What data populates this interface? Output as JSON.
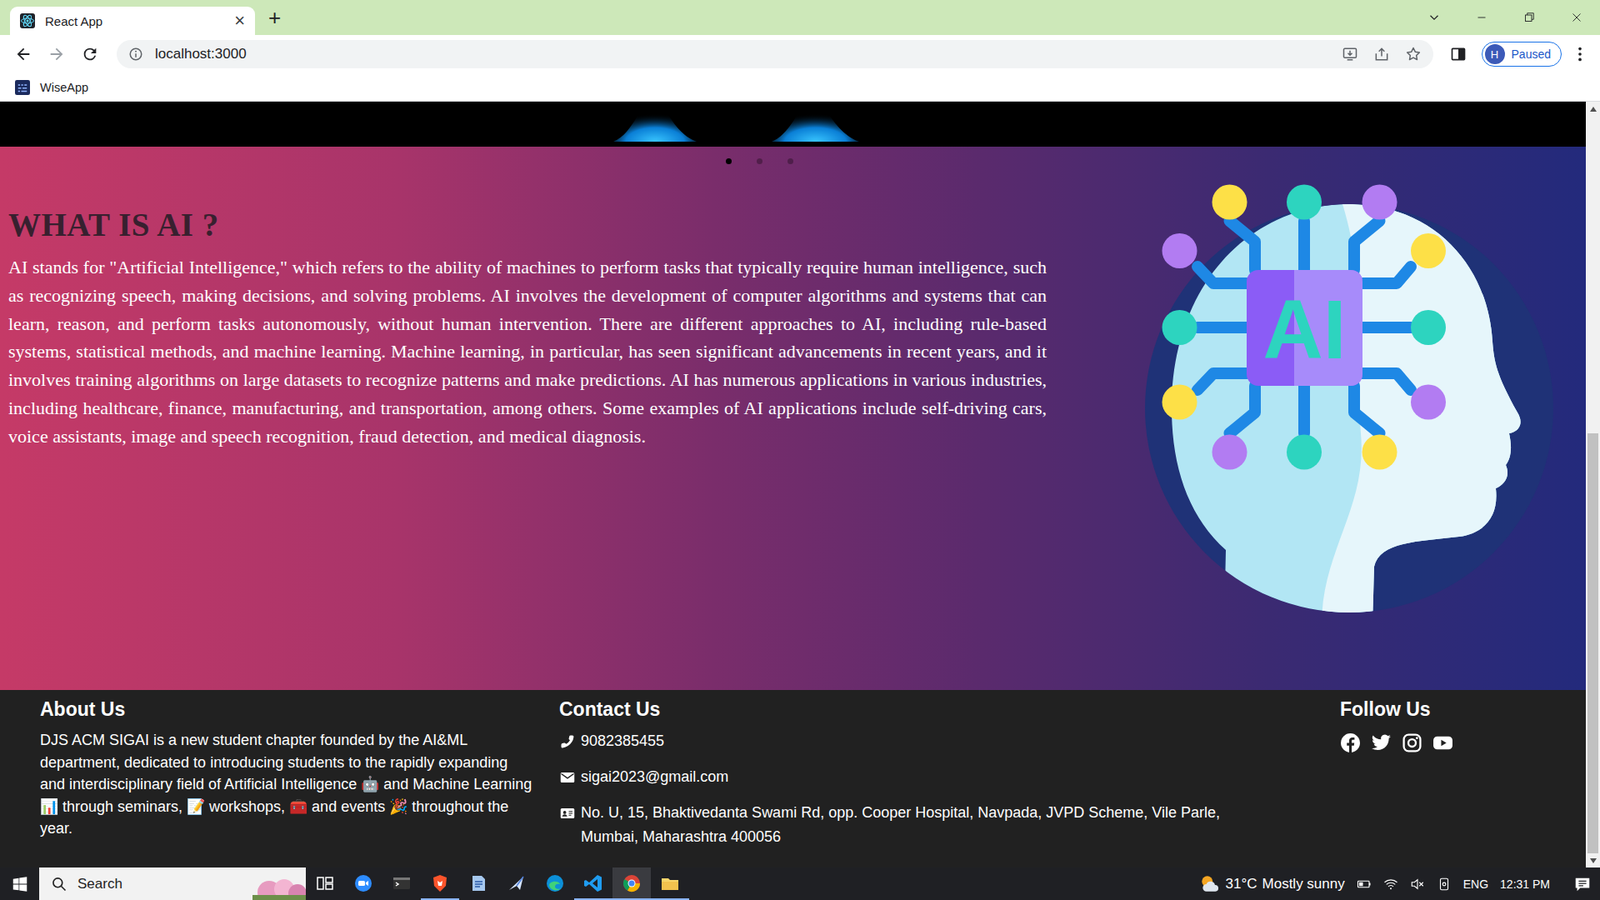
{
  "browser": {
    "tabs": [
      {
        "label": "React App",
        "selected": true
      }
    ],
    "tab_close": "×",
    "new_tab": "+",
    "address": "localhost:3000",
    "profile": {
      "initial": "H",
      "status": "Paused"
    },
    "bookmarks": [
      {
        "label": "WiseApp"
      }
    ]
  },
  "carousel": {
    "dots": [
      {
        "selected": true
      },
      {
        "selected": false
      },
      {
        "selected": false
      }
    ]
  },
  "section": {
    "heading": "WHAT IS AI ?",
    "body": "AI stands for \"Artificial Intelligence,\" which refers to the ability of machines to perform tasks that typically require human intelligence, such as recognizing speech, making decisions, and solving problems. AI involves the development of computer algorithms and systems that can learn, reason, and perform tasks autonomously, without human intervention. There are different approaches to AI, including rule-based systems, statistical methods, and machine learning. Machine learning, in particular, has seen significant advancements in recent years, and it involves training algorithms on large datasets to recognize patterns and make predictions. AI has numerous applications in various industries, including healthcare, finance, manufacturing, and transportation, among others. Some examples of AI applications include self-driving cars, voice assistants, image and speech recognition, fraud detection, and medical diagnosis.",
    "illustration_label": "AI"
  },
  "footer": {
    "about": {
      "heading": "About Us",
      "text": "DJS ACM SIGAI is a new student chapter founded by the AI&ML department, dedicated to introducing students to the rapidly expanding and interdisciplinary field of Artificial Intelligence 🤖 and Machine Learning 📊 through seminars, 📝 workshops, 🧰 and events 🎉 throughout the year."
    },
    "contact": {
      "heading": "Contact Us",
      "items": [
        {
          "kind": "phone",
          "text": "9082385455"
        },
        {
          "kind": "email",
          "text": "sigai2023@gmail.com"
        },
        {
          "kind": "address",
          "text": "No. U, 15, Bhaktivedanta Swami Rd, opp. Cooper Hospital, Navpada, JVPD Scheme, Vile Parle, Mumbai, Maharashtra 400056"
        }
      ]
    },
    "follow": {
      "heading": "Follow Us",
      "links": [
        {
          "kind": "facebook"
        },
        {
          "kind": "twitter"
        },
        {
          "kind": "instagram"
        },
        {
          "kind": "youtube"
        }
      ]
    }
  },
  "taskbar": {
    "search_placeholder": "Search",
    "apps": [
      {
        "kind": "taskview",
        "open": false,
        "selected": false
      },
      {
        "kind": "zoom",
        "open": false,
        "selected": false
      },
      {
        "kind": "terminal",
        "open": false,
        "selected": false
      },
      {
        "kind": "brave",
        "open": true,
        "selected": false
      },
      {
        "kind": "notes",
        "open": false,
        "selected": false
      },
      {
        "kind": "arrow",
        "open": false,
        "selected": false
      },
      {
        "kind": "edge",
        "open": false,
        "selected": false
      },
      {
        "kind": "vscode",
        "open": true,
        "selected": false
      },
      {
        "kind": "chrome",
        "open": true,
        "selected": true
      },
      {
        "kind": "files",
        "open": true,
        "selected": false
      }
    ],
    "weather": {
      "temp": "31°C",
      "condition": "Mostly sunny"
    },
    "language": "ENG",
    "time": "12:31 PM"
  }
}
